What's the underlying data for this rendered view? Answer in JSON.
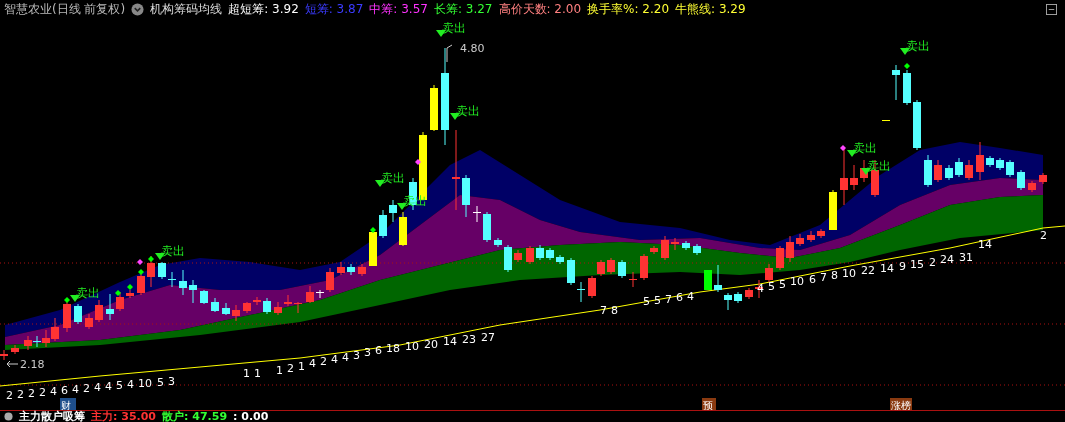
{
  "header": {
    "title": "智慧农业(日线 前复权)",
    "indicator": "机构筹码均线",
    "values": [
      {
        "label": "超短筹: 3.92",
        "color": "#ffffff"
      },
      {
        "label": "短筹: 3.87",
        "color": "#3b3bff"
      },
      {
        "label": "中筹: 3.57",
        "color": "#ff33ff"
      },
      {
        "label": "长筹: 3.27",
        "color": "#33ff33"
      },
      {
        "label": "高价天数: 2.00",
        "color": "#ff8080"
      },
      {
        "label": "换手率%: 2.20",
        "color": "#ffff33"
      },
      {
        "label": "牛熊线: 3.29",
        "color": "#ffff33"
      }
    ]
  },
  "chart": {
    "sell_signals": [
      "卖出",
      "卖出",
      "卖出",
      "卖出",
      "卖出",
      "卖出",
      "卖出",
      "卖出",
      "卖出"
    ],
    "price_labels": [
      "4.80",
      "2.18"
    ],
    "count_labels": [
      [
        "2",
        "2",
        "2",
        "2",
        "4",
        "6",
        "4",
        "2",
        "4",
        "4",
        "5",
        "4",
        "10",
        "5",
        "3"
      ],
      [
        "1",
        "1"
      ],
      [
        "1",
        "2",
        "1",
        "4",
        "2",
        "4",
        "4",
        "3",
        "3",
        "6",
        "18",
        "10",
        "20",
        "14",
        "23",
        "27"
      ],
      [
        "7",
        "8"
      ],
      [
        "5",
        "5",
        "7",
        "6",
        "4"
      ],
      [
        "4",
        "5",
        "5",
        "10",
        "6",
        "7",
        "8",
        "10",
        "22",
        "14",
        "9",
        "15",
        "2",
        "24",
        "31"
      ],
      [
        "14"
      ],
      [
        "2"
      ]
    ],
    "event_markers": [
      {
        "label": "财",
        "color": "#1e4f8c"
      },
      {
        "label": "预",
        "color": "#8a3a10"
      },
      {
        "label": "涨榜",
        "color": "#8a3a10"
      }
    ]
  },
  "status_bar": {
    "title": "主力散户吸筹",
    "values": [
      {
        "label": "主力: 35.00",
        "color": "#ff3333"
      },
      {
        "label": "散户: 47.59",
        "color": "#33ff33"
      },
      {
        "label": ": 0.00",
        "color": "#ffffff"
      }
    ]
  }
}
